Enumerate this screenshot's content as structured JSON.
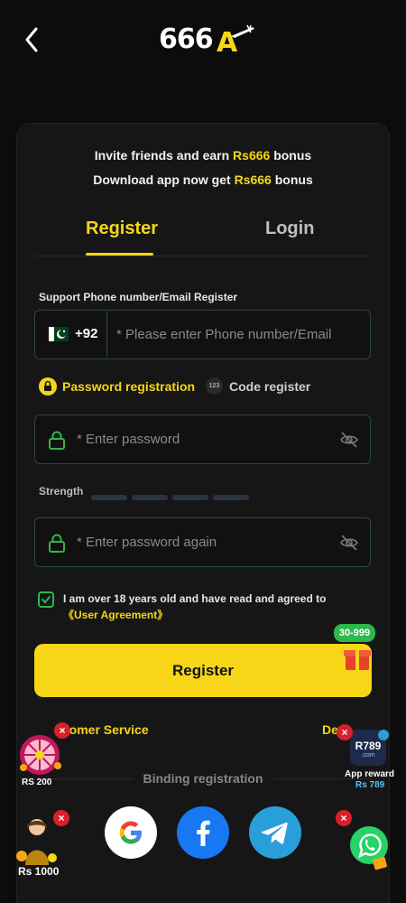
{
  "header": {
    "logo_text": "666",
    "logo_letter": "A"
  },
  "invite": {
    "line1_prefix": "Invite friends and earn ",
    "line1_amount": "Rs666",
    "line1_suffix": " bonus",
    "line2_prefix": "Download app now get ",
    "line2_amount": "Rs666",
    "line2_suffix": " bonus"
  },
  "tabs": [
    {
      "label": "Register",
      "active": true
    },
    {
      "label": "Login",
      "active": false
    }
  ],
  "form": {
    "support_label": "Support Phone number/Email Register",
    "country_code": "+92",
    "phone_placeholder": "* Please enter Phone number/Email",
    "mode_password": "Password registration",
    "mode_code": "Code register",
    "mode_code_icon_text": "123",
    "password_placeholder": "* Enter password",
    "strength_label": "Strength",
    "strength_level": 0,
    "password_again_placeholder": "* Enter password again",
    "agree_text": "I am over 18 years old and have read and agreed to ",
    "agree_link": "《User Agreement》",
    "agree_checked": true,
    "register_button": "Register",
    "promo_badge": "30-999"
  },
  "links": {
    "customer_service": "tomer Service",
    "download": "De"
  },
  "binding": {
    "label": "Binding registration"
  },
  "floats": {
    "wheel_label": "RS 200",
    "girl_label": "Rs 1000",
    "app_reward_label": "App reward",
    "app_reward_amount": "Rs 789",
    "app_icon_text": "R789",
    "app_icon_sub": ".com"
  },
  "colors": {
    "accent": "#f6d617",
    "background": "#0c0c0c",
    "card": "#161616",
    "green": "#2cb84c",
    "close_red": "#d8202a"
  },
  "icons": [
    "back-arrow-icon",
    "pakistan-flag-icon",
    "lock-icon",
    "eye-off-icon",
    "google-icon",
    "facebook-icon",
    "telegram-icon",
    "whatsapp-icon",
    "gift-icon"
  ]
}
